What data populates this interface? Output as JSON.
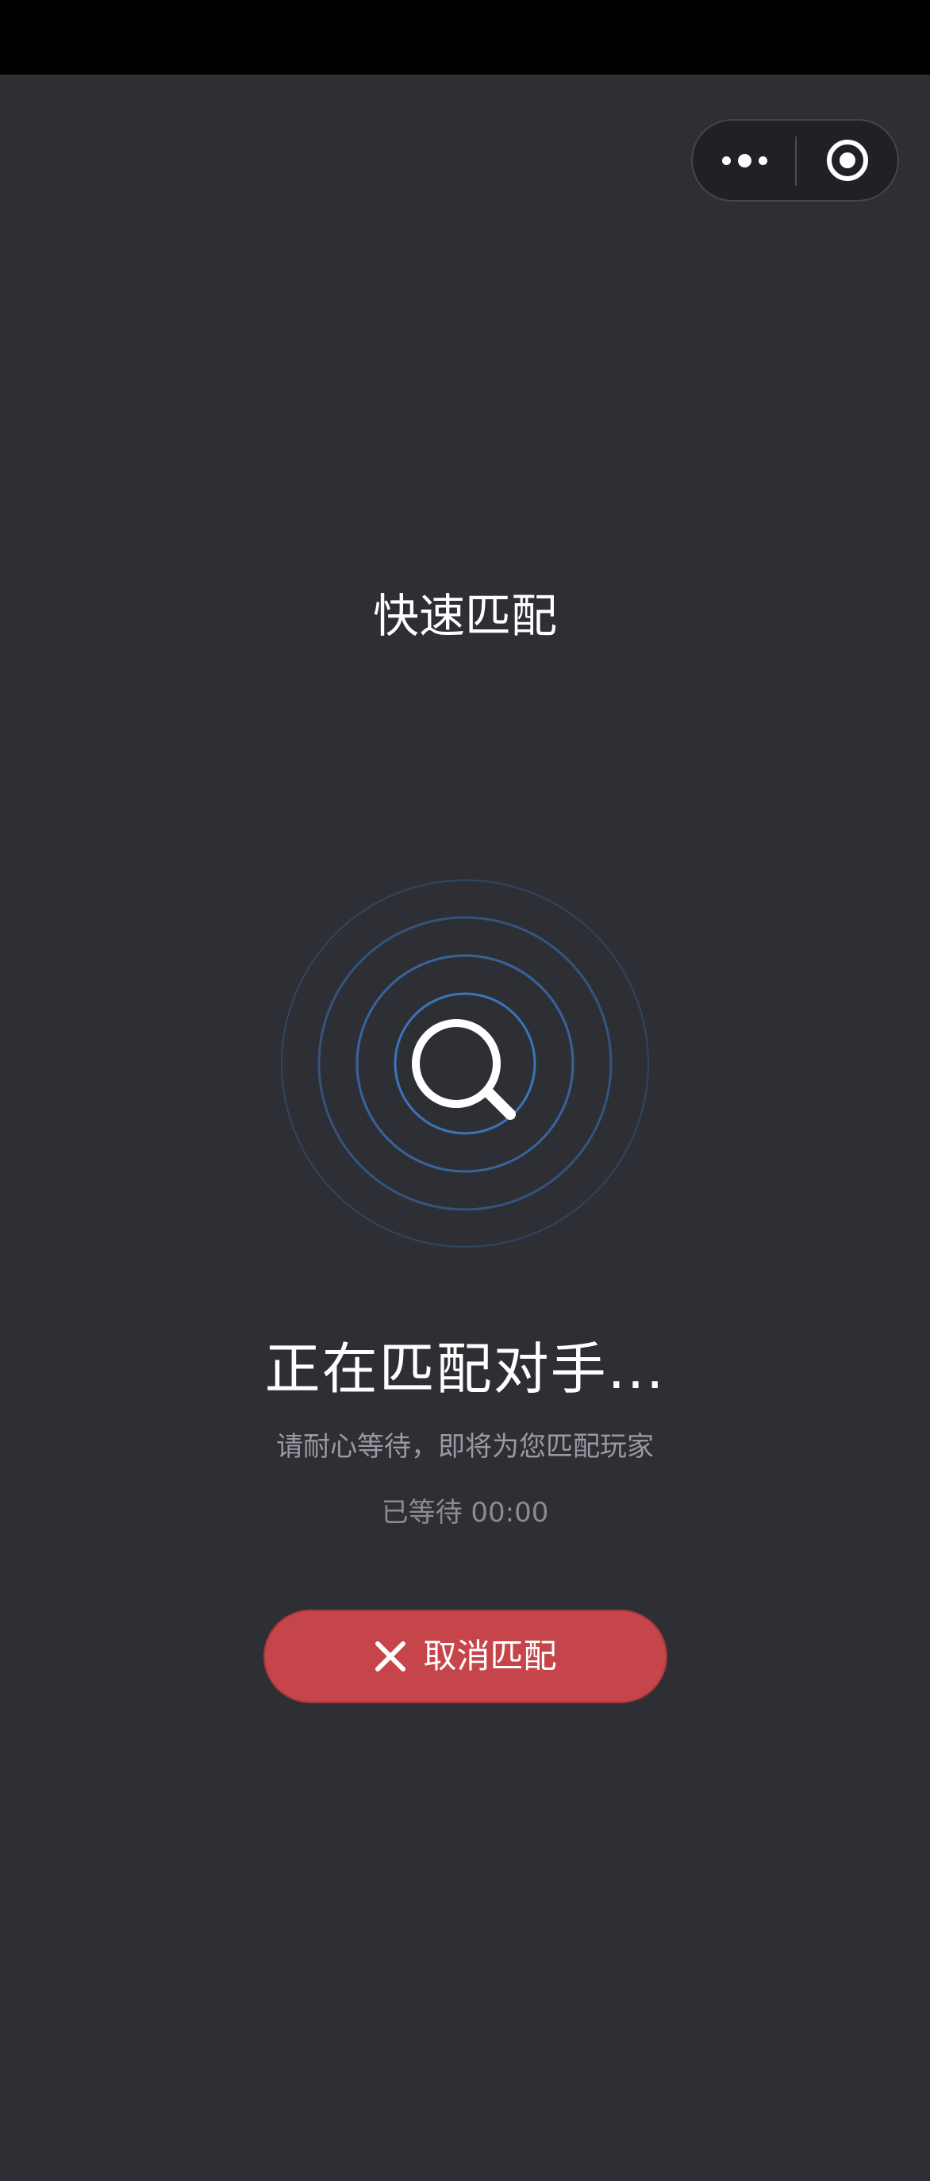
{
  "header": {
    "title": "快速匹配"
  },
  "capsule": {
    "more_icon": "more-dots-icon",
    "close_icon": "target-ring-icon"
  },
  "matching": {
    "icon": "search-icon",
    "title": "正在匹配对手...",
    "subtitle": "请耐心等待，即将为您匹配玩家",
    "wait_label": "已等待",
    "wait_time": "00:00"
  },
  "cancel_button": {
    "icon": "close-icon",
    "label": "取消匹配"
  },
  "colors": {
    "background": "#2e2f35",
    "status_bar": "#000000",
    "radar_blue": "#3b78c4",
    "cancel_red": "#c6454a",
    "text_primary": "#ffffff",
    "text_secondary": "#9a9ba2"
  }
}
